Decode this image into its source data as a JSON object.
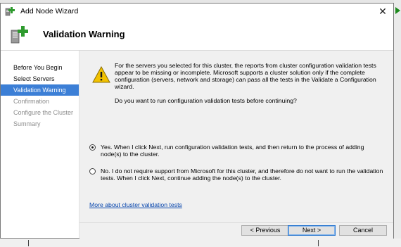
{
  "window": {
    "title": "Add Node Wizard",
    "close_glyph": "✕"
  },
  "header": {
    "title": "Validation Warning",
    "icon": "server-plus-icon"
  },
  "sidebar": {
    "items": [
      {
        "label": "Before You Begin",
        "state": "done"
      },
      {
        "label": "Select Servers",
        "state": "done"
      },
      {
        "label": "Validation Warning",
        "state": "active"
      },
      {
        "label": "Confirmation",
        "state": "pending"
      },
      {
        "label": "Configure the Cluster",
        "state": "pending"
      },
      {
        "label": "Summary",
        "state": "pending"
      }
    ]
  },
  "content": {
    "warning_icon": "warning-icon",
    "message": "For the servers you selected for this cluster, the reports from cluster configuration validation tests appear to be missing or incomplete.  Microsoft supports a cluster solution only if the complete configuration (servers, network and storage) can pass all the tests in the Validate a Configuration wizard.",
    "question": "Do you want to run configuration validation tests before continuing?",
    "options": [
      {
        "label": "Yes.  When I click Next, run configuration validation tests, and then return to the process of adding node(s) to the cluster.",
        "selected": true
      },
      {
        "label": "No.  I do not require support from Microsoft for this cluster, and therefore do not want to run the validation tests.  When I click Next, continue adding the node(s) to the cluster.",
        "selected": false
      }
    ],
    "link": "More about cluster validation tests"
  },
  "footer": {
    "previous_label": "< Previous",
    "next_label": "Next >",
    "cancel_label": "Cancel"
  },
  "colors": {
    "accent": "#3c7fd6",
    "link": "#0645ad",
    "panel_bg": "#f0f0f0"
  }
}
